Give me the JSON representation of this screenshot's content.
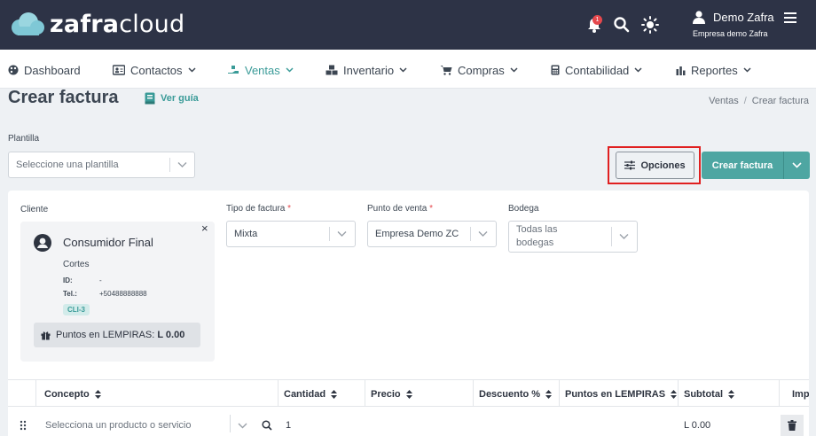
{
  "brand": {
    "logo_text_bold": "zafra",
    "logo_text_light": "cloud",
    "accent": "#3a9b98",
    "topbar_color": "#2d3346"
  },
  "header": {
    "notification_count": "1",
    "user_name": "Demo Zafra",
    "company": "Empresa demo Zafra",
    "icons": [
      "bell-icon",
      "search-icon",
      "sun-icon",
      "user-icon",
      "menu-icon"
    ]
  },
  "nav": {
    "items": [
      {
        "label": "Dashboard",
        "icon": "palette-icon"
      },
      {
        "label": "Contactos",
        "icon": "contacts-icon"
      },
      {
        "label": "Ventas",
        "icon": "sales-icon"
      },
      {
        "label": "Inventario",
        "icon": "boxes-icon"
      },
      {
        "label": "Compras",
        "icon": "cart-icon"
      },
      {
        "label": "Contabilidad",
        "icon": "calculator-icon"
      },
      {
        "label": "Reportes",
        "icon": "chart-icon"
      }
    ]
  },
  "page": {
    "title": "Crear factura",
    "guide_label": "Ver guía",
    "breadcrumb": [
      "Ventas",
      "Crear factura"
    ],
    "breadcrumb_sep": "/"
  },
  "template": {
    "label": "Plantilla",
    "placeholder": "Seleccione una plantilla"
  },
  "actions": {
    "options_label": "Opciones",
    "create_label": "Crear factura"
  },
  "form": {
    "cliente_label": "Cliente",
    "tipo_label": "Tipo de factura",
    "tipo_value": "Mixta",
    "punto_label": "Punto de venta",
    "punto_value": "Empresa Demo ZC",
    "bodega_label": "Bodega",
    "bodega_value_line1": "Todas las",
    "bodega_value_line2": "bodegas",
    "required_mark": "*"
  },
  "client": {
    "name": "Consumidor Final",
    "subtitle": "Cortes",
    "id_label": "ID:",
    "id_value": "-",
    "tel_label": "Tel.:",
    "tel_value": "+50488888888",
    "code": "CLI-3",
    "points_label": "Puntos en LEMPIRAS:",
    "points_value": "L 0.00",
    "close": "×"
  },
  "table": {
    "headers": [
      "Concepto",
      "Cantidad",
      "Precio",
      "Descuento %",
      "Puntos en LEMPIRAS",
      "Subtotal",
      "Imp"
    ],
    "row": {
      "product_placeholder": "Selecciona un producto o servicio",
      "quantity": "1",
      "subtotal": "L 0.00"
    }
  }
}
